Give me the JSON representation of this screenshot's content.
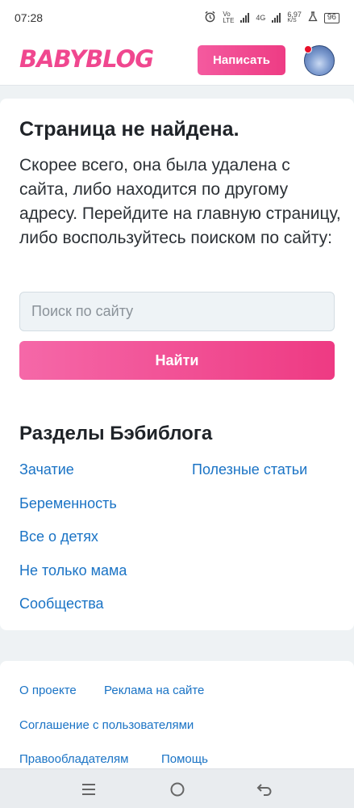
{
  "status_bar": {
    "time": "07:28",
    "network_1": "Vo LTE",
    "network_2": "4G",
    "speed": "6,97",
    "speed_unit": "K/S",
    "battery": "96"
  },
  "header": {
    "logo": "BABYBLOG",
    "write_button": "Написать"
  },
  "main": {
    "title": "Страница не найдена.",
    "description": "Скорее всего, она была удалена с сайта, либо находится по другому адресу. Перейдите на главную страницу, либо воспользуйтесь поиском по сайту:",
    "search_placeholder": "Поиск по сайту",
    "search_button": "Найти",
    "sections_title": "Разделы Бэбиблога",
    "sections": {
      "conception": "Зачатие",
      "useful_articles": "Полезные статьи",
      "pregnancy": "Беременность",
      "about_children": "Все о детях",
      "not_only_mom": "Не только мама",
      "communities": "Сообщества"
    }
  },
  "footer": {
    "about": "О проекте",
    "advertising": "Реклама на сайте",
    "agreement": "Соглашение с пользователями",
    "copyright": "Правообладателям",
    "help": "Помощь"
  },
  "nav": {
    "menu_icon": "menu-icon",
    "home_icon": "home-icon",
    "back_icon": "back-icon"
  },
  "colors": {
    "brand": "#f0478f",
    "link": "#1a73c5"
  }
}
